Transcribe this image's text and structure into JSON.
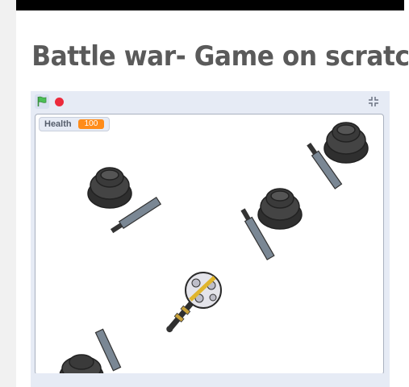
{
  "page": {
    "title": "Battle war- Game on scratch"
  },
  "player": {
    "controls": {
      "green_flag": {
        "icon": "green-flag-icon",
        "color": "#4cbf56"
      },
      "stop": {
        "icon": "stop-icon",
        "color": "#ec2a3b"
      },
      "fullscreen": {
        "icon": "fullscreen-icon"
      }
    },
    "monitor": {
      "label": "Health",
      "value": "100",
      "value_color": "#ff8c1a"
    }
  },
  "stage": {
    "sprites": [
      {
        "kind": "enemy",
        "icon": "enemy-knight-icon"
      },
      {
        "kind": "enemy",
        "icon": "enemy-knight-icon"
      },
      {
        "kind": "enemy",
        "icon": "enemy-knight-icon"
      },
      {
        "kind": "enemy",
        "icon": "enemy-knight-icon"
      },
      {
        "kind": "player",
        "icon": "player-mace-icon"
      }
    ]
  },
  "colors": {
    "title_text": "#5a5a5a",
    "player_bg": "#e6ebf5",
    "stage_bg": "#ffffff",
    "helmet": "#3b3b3b",
    "blade": "#7a8794"
  }
}
